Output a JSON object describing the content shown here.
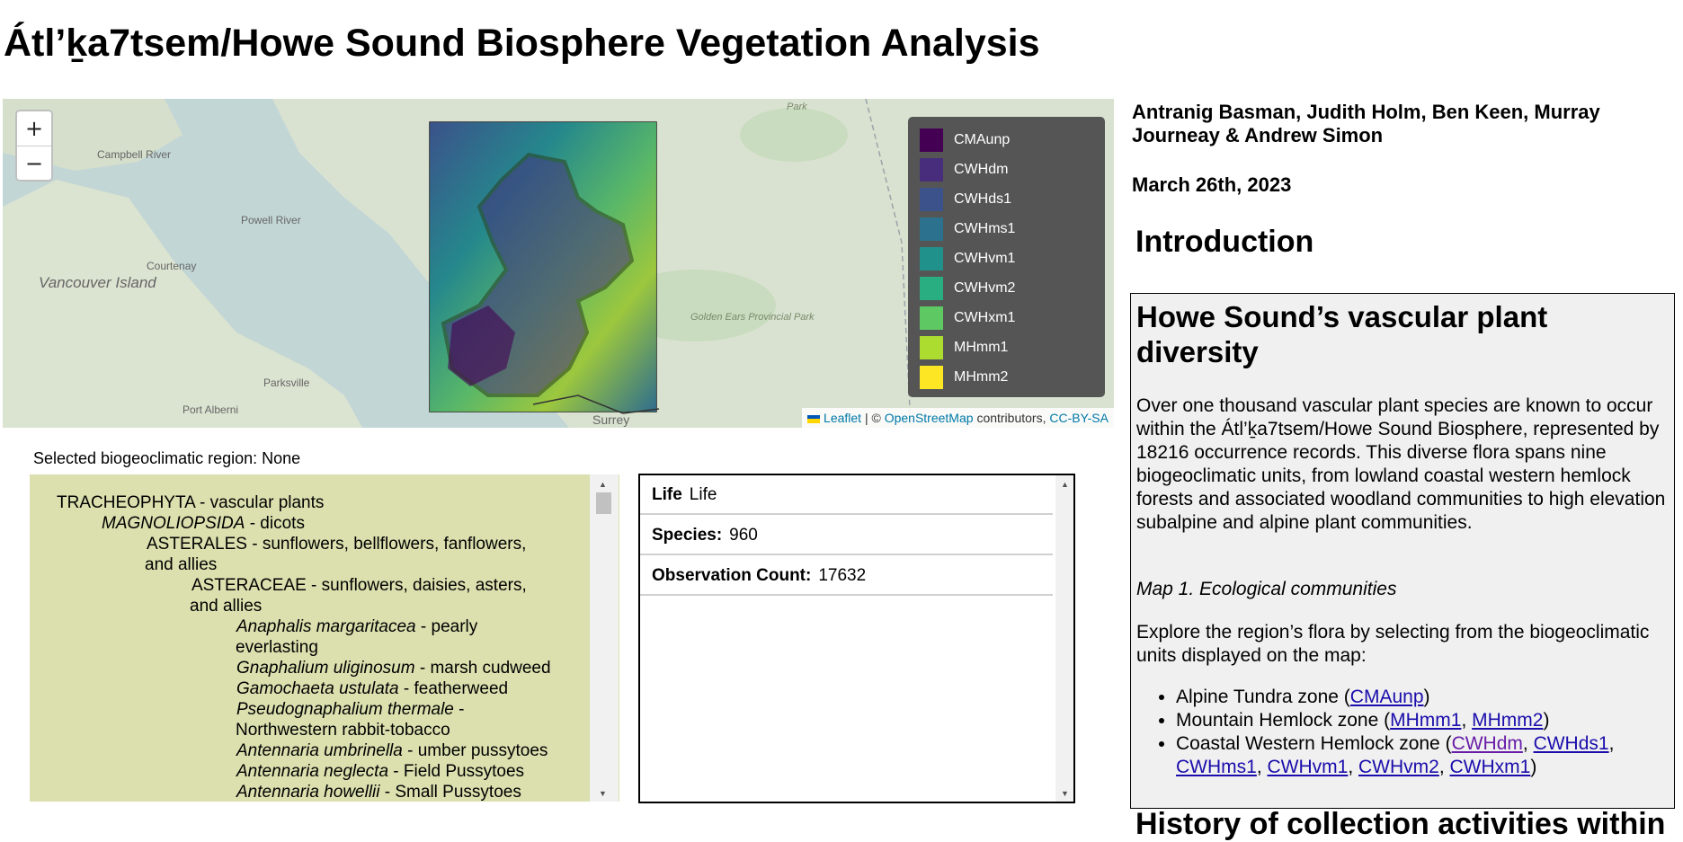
{
  "page": {
    "title": "Átl’ḵa7tsem/Howe Sound Biosphere Vegetation Analysis"
  },
  "map": {
    "zoom_in_label": "+",
    "zoom_out_label": "−",
    "place_labels": [
      "Campbell River",
      "Powell River",
      "Courtenay",
      "Vancouver Island",
      "Parksville",
      "Port Alberni",
      "Golden Ears Provincial Park",
      "Surrey",
      "Park"
    ],
    "legend": [
      {
        "label": "CMAunp",
        "color": "#440154"
      },
      {
        "label": "CWHdm",
        "color": "#472d7b"
      },
      {
        "label": "CWHds1",
        "color": "#3b528b"
      },
      {
        "label": "CWHms1",
        "color": "#2c728e"
      },
      {
        "label": "CWHvm1",
        "color": "#21918c"
      },
      {
        "label": "CWHvm2",
        "color": "#28ae80"
      },
      {
        "label": "CWHxm1",
        "color": "#5ec962"
      },
      {
        "label": "MHmm1",
        "color": "#addc30"
      },
      {
        "label": "MHmm2",
        "color": "#fde725"
      }
    ],
    "attribution": {
      "leaflet": "Leaflet",
      "separator": "| ©",
      "osm": "OpenStreetMap",
      "contributors": "contributors,",
      "license": "CC-BY-SA"
    }
  },
  "selection": {
    "text": "Selected biogeoclimatic region: None"
  },
  "tree": {
    "rows": [
      {
        "name": "TRACHEOPHYTA",
        "common": " - vascular plants",
        "italic": false,
        "level": 0
      },
      {
        "name": "MAGNOLIOPSIDA",
        "common": " - dicots",
        "italic": true,
        "level": 1
      },
      {
        "name": "ASTERALES",
        "common": " - sunflowers, bellflowers, fanflowers,",
        "italic": false,
        "level": 2
      },
      {
        "name": "",
        "common": "and allies",
        "italic": false,
        "level": 2
      },
      {
        "name": "ASTERACEAE",
        "common": " - sunflowers, daisies, asters,",
        "italic": false,
        "level": 3
      },
      {
        "name": "",
        "common": "and allies",
        "italic": false,
        "level": 3
      },
      {
        "name": "Anaphalis margaritacea",
        "common": " - pearly",
        "italic": true,
        "level": 4
      },
      {
        "name": "",
        "common": "everlasting",
        "italic": false,
        "level": 4
      },
      {
        "name": "Gnaphalium uliginosum",
        "common": " - marsh cudweed",
        "italic": true,
        "level": 4
      },
      {
        "name": "Gamochaeta ustulata",
        "common": " - featherweed",
        "italic": true,
        "level": 4
      },
      {
        "name": "Pseudognaphalium thermale",
        "common": " -",
        "italic": true,
        "level": 4
      },
      {
        "name": "",
        "common": "Northwestern rabbit-tobacco",
        "italic": false,
        "level": 4
      },
      {
        "name": "Antennaria umbrinella",
        "common": " - umber pussytoes",
        "italic": true,
        "level": 4
      },
      {
        "name": "Antennaria neglecta",
        "common": " - Field Pussytoes",
        "italic": true,
        "level": 4
      },
      {
        "name": "Antennaria howellii",
        "common": " - Small Pussytoes",
        "italic": true,
        "level": 4
      }
    ]
  },
  "info": {
    "rows": [
      {
        "label": "Life",
        "value": "Life"
      },
      {
        "label": "Species:",
        "value": "960"
      },
      {
        "label": "Observation Count:",
        "value": "17632"
      }
    ]
  },
  "sidebar": {
    "authors": "Antranig Basman, Judith Holm, Ben Keen, Murray Journeay & Andrew Simon",
    "date": "March 26th, 2023",
    "intro_heading": "Introduction",
    "box": {
      "heading": "Howe Sound’s vascular plant diversity",
      "paragraph1": "Over one thousand vascular plant species are known to occur within the Átl’ḵa7tsem/Howe Sound Biosphere, represented by 18216 occurrence records. This diverse flora spans nine biogeoclimatic units, from lowland coastal western hemlock forests and associated woodland communities to high elevation subalpine and alpine plant communities.",
      "caption": "Map 1. Ecological communities",
      "paragraph2": "Explore the region’s flora by selecting from the biogeoclimatic units displayed on the map:",
      "zones": [
        {
          "name": "Alpine Tundra zone (",
          "links": [
            "CMAunp"
          ],
          "close": ")"
        },
        {
          "name": "Mountain Hemlock zone (",
          "links": [
            "MHmm1",
            "MHmm2"
          ],
          "close": ")"
        },
        {
          "name": "Coastal Western Hemlock zone (",
          "links": [
            "CWHdm",
            "CWHds1",
            "CWHms1",
            "CWHvm1",
            "CWHvm2",
            "CWHxm1"
          ],
          "close": ")"
        }
      ]
    },
    "next_heading": "History of collection activities within"
  }
}
